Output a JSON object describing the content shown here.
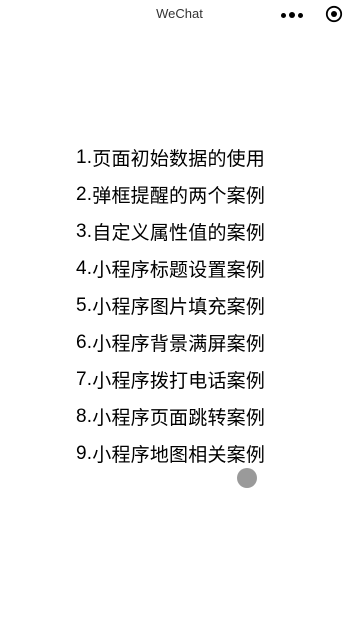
{
  "nav": {
    "title": "WeChat",
    "more_icon": "more-dots-icon",
    "close_icon": "capsule-close-icon"
  },
  "menu": {
    "items": [
      {
        "num": "1.",
        "label": "页面初始数据的使用"
      },
      {
        "num": "2.",
        "label": "弹框提醒的两个案例"
      },
      {
        "num": "3.",
        "label": "自定义属性值的案例"
      },
      {
        "num": "4.",
        "label": "小程序标题设置案例"
      },
      {
        "num": "5.",
        "label": "小程序图片填充案例"
      },
      {
        "num": "6.",
        "label": "小程序背景满屏案例"
      },
      {
        "num": "7.",
        "label": "小程序拨打电话案例"
      },
      {
        "num": "8.",
        "label": "小程序页面跳转案例"
      },
      {
        "num": "9.",
        "label": "小程序地图相关案例"
      }
    ]
  },
  "colors": {
    "background": "#ffffff",
    "text": "#000000",
    "nav_title": "#333333",
    "touch_indicator": "#787878"
  }
}
